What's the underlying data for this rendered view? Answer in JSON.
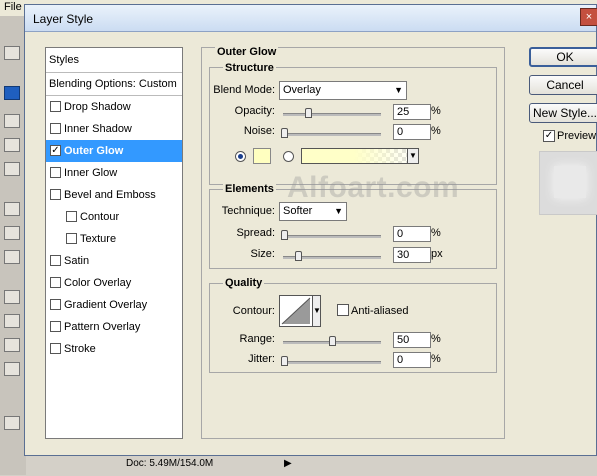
{
  "app": {
    "menu_first": "File"
  },
  "dialog": {
    "title": "Layer Style",
    "close_glyph": "×"
  },
  "styles_list": {
    "header": "Styles",
    "blending": "Blending Options: Custom",
    "items": [
      {
        "label": "Drop Shadow",
        "checked": false,
        "indent": false
      },
      {
        "label": "Inner Shadow",
        "checked": false,
        "indent": false
      },
      {
        "label": "Outer Glow",
        "checked": true,
        "indent": false,
        "selected": true
      },
      {
        "label": "Inner Glow",
        "checked": false,
        "indent": false
      },
      {
        "label": "Bevel and Emboss",
        "checked": false,
        "indent": false
      },
      {
        "label": "Contour",
        "checked": false,
        "indent": true
      },
      {
        "label": "Texture",
        "checked": false,
        "indent": true
      },
      {
        "label": "Satin",
        "checked": false,
        "indent": false
      },
      {
        "label": "Color Overlay",
        "checked": false,
        "indent": false
      },
      {
        "label": "Gradient Overlay",
        "checked": false,
        "indent": false
      },
      {
        "label": "Pattern Overlay",
        "checked": false,
        "indent": false
      },
      {
        "label": "Stroke",
        "checked": false,
        "indent": false
      }
    ]
  },
  "outer_glow": {
    "title": "Outer Glow",
    "structure": {
      "title": "Structure",
      "blend_mode_label": "Blend Mode:",
      "blend_mode_value": "Overlay",
      "opacity_label": "Opacity:",
      "opacity_value": "25",
      "noise_label": "Noise:",
      "noise_value": "0",
      "unit_percent": "%",
      "glow_color": "#ffffc0"
    },
    "elements": {
      "title": "Elements",
      "technique_label": "Technique:",
      "technique_value": "Softer",
      "spread_label": "Spread:",
      "spread_value": "0",
      "size_label": "Size:",
      "size_value": "30",
      "unit_percent": "%",
      "unit_px": "px"
    },
    "quality": {
      "title": "Quality",
      "contour_label": "Contour:",
      "anti_aliased_label": "Anti-aliased",
      "anti_aliased_checked": false,
      "range_label": "Range:",
      "range_value": "50",
      "jitter_label": "Jitter:",
      "jitter_value": "0",
      "unit_percent": "%"
    }
  },
  "buttons": {
    "ok": "OK",
    "cancel": "Cancel",
    "new_style": "New Style...",
    "preview_label": "Preview",
    "preview_checked": true
  },
  "status": {
    "doc": "Doc: 5.49M/154.0M"
  },
  "watermark": "Alfoart.com"
}
